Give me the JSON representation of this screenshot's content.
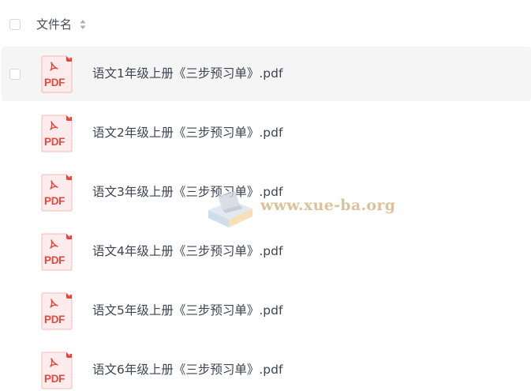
{
  "header": {
    "column_label": "文件名"
  },
  "icons": {
    "file_icon": "pdf-file-icon",
    "sort_icon": "sort-up-down-icon",
    "pdf_badge_text": "PDF"
  },
  "colors": {
    "pdf_red": "#e8463c",
    "pdf_bg": "#fdeceb",
    "hover_row": "#f5f5f6",
    "text": "#3d4452"
  },
  "files": [
    {
      "name": "语文1年级上册《三步预习单》.pdf"
    },
    {
      "name": "语文2年级上册《三步预习单》.pdf"
    },
    {
      "name": "语文3年级上册《三步预习单》.pdf"
    },
    {
      "name": "语文4年级上册《三步预习单》.pdf"
    },
    {
      "name": "语文5年级上册《三步预习单》.pdf"
    },
    {
      "name": "语文6年级上册《三步预习单》.pdf"
    }
  ],
  "watermark": {
    "text": "www.xue-ba.org"
  }
}
